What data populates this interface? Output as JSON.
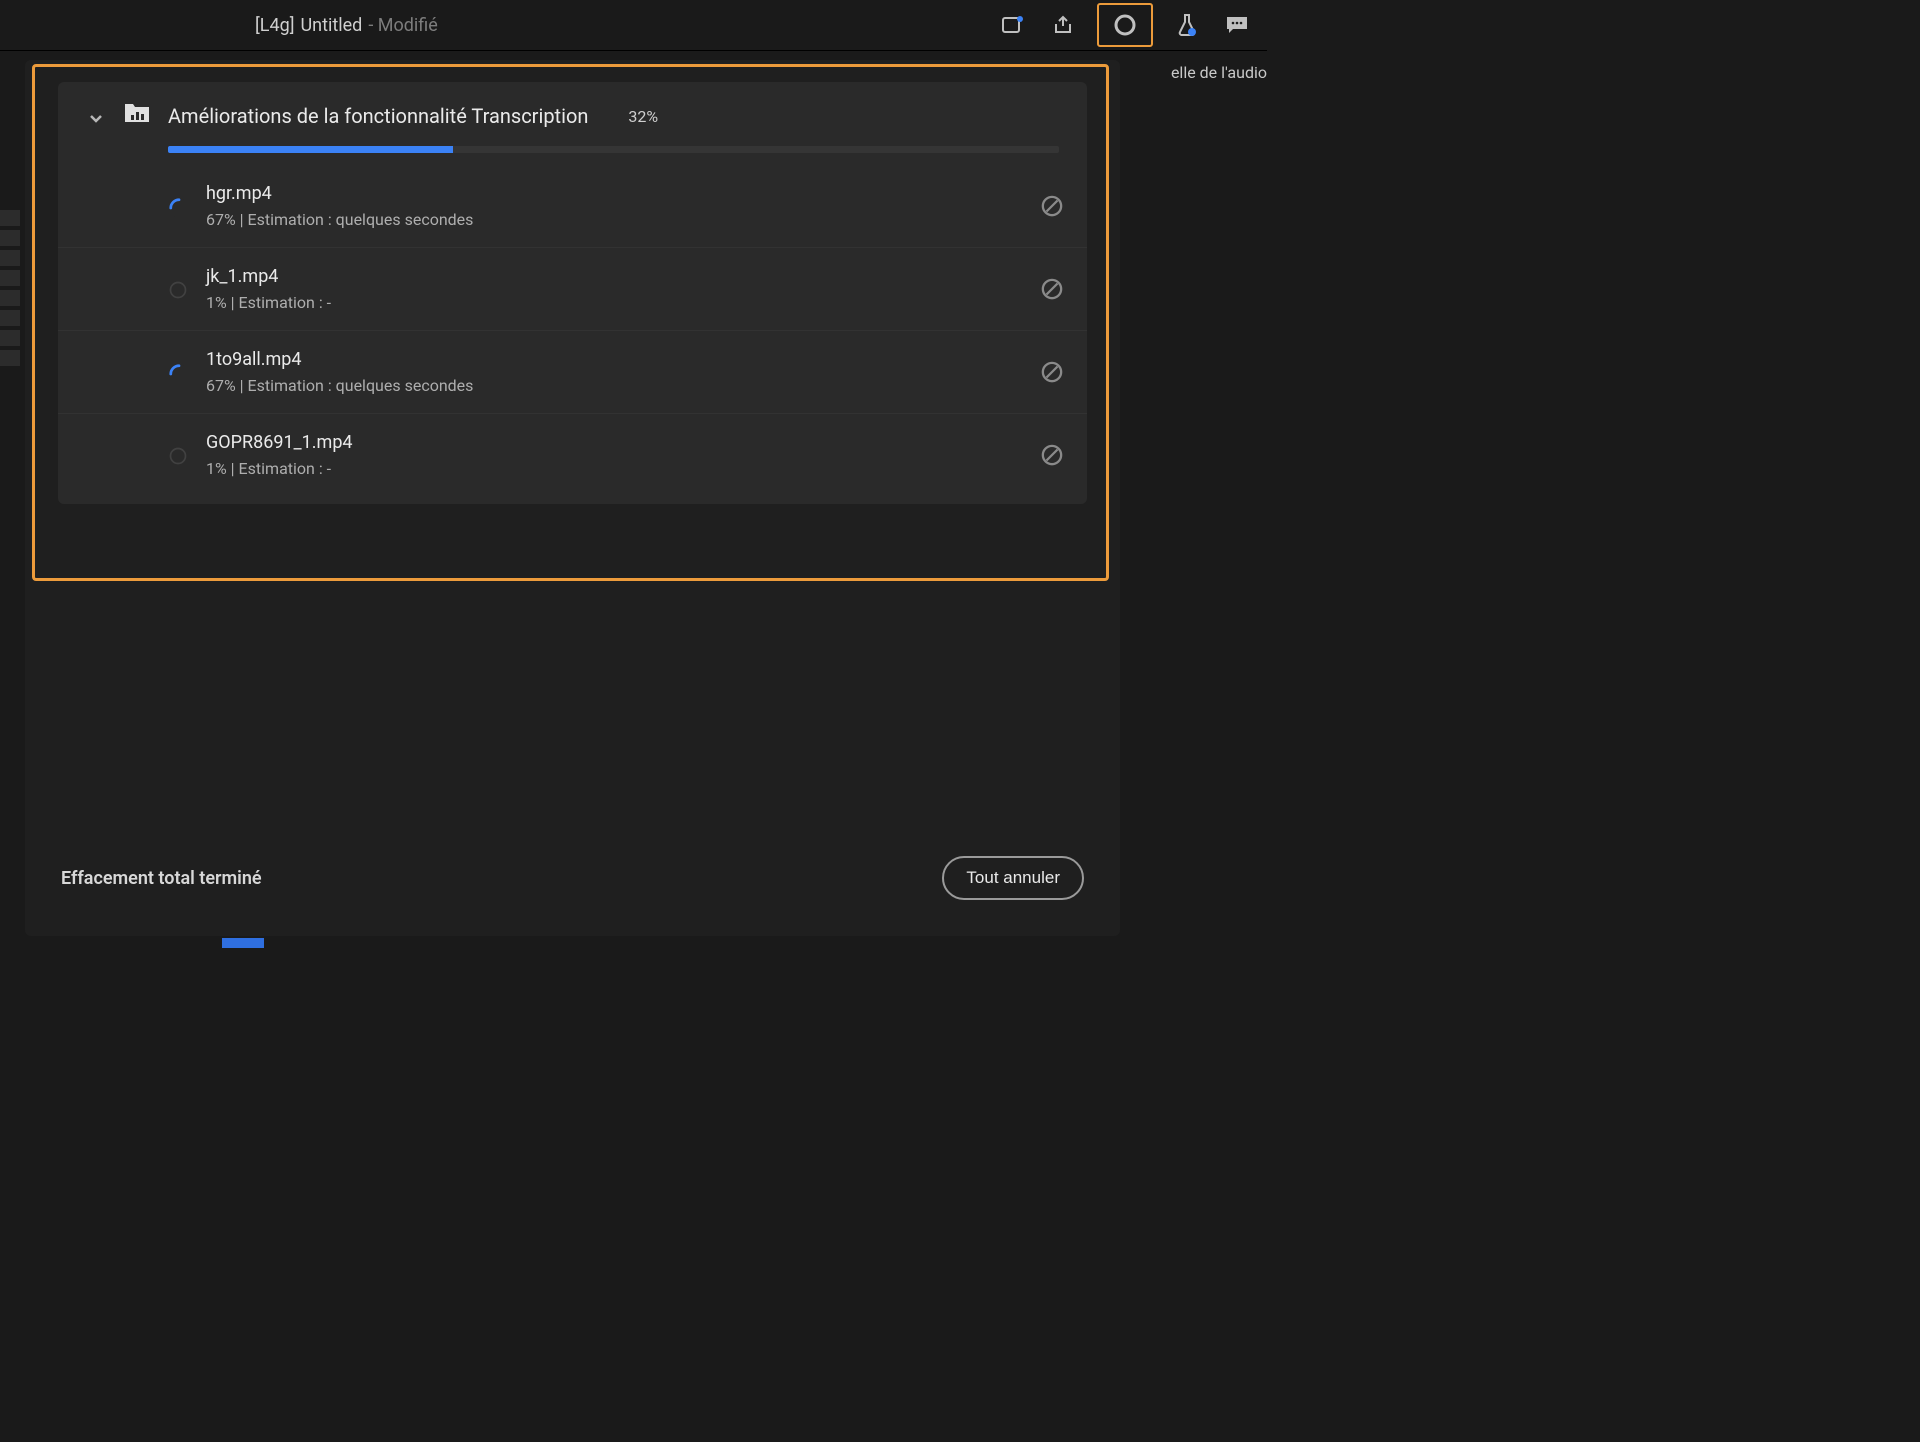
{
  "titlebar": {
    "prefix": "[L4g]",
    "name": "Untitled",
    "modified": "- Modifié"
  },
  "partial_right_text": "elle de l'audio",
  "panel": {
    "title": "Améliorations de la fonctionnalité Transcription",
    "percent_label": "32%",
    "progress_percent": 32,
    "footer_status": "Effacement total terminé",
    "cancel_all_label": "Tout annuler"
  },
  "jobs": [
    {
      "spinner": "active",
      "name": "hgr.mp4",
      "status": "67%  |  Estimation : quelques secondes"
    },
    {
      "spinner": "idle",
      "name": "jk_1.mp4",
      "status": "1%  |  Estimation : -"
    },
    {
      "spinner": "active",
      "name": "1to9all.mp4",
      "status": "67%  |  Estimation : quelques secondes"
    },
    {
      "spinner": "idle",
      "name": "GOPR8691_1.mp4",
      "status": "1%  |  Estimation : -"
    }
  ],
  "icons": {
    "note": "notification-icon",
    "share": "share-icon",
    "circle": "progress-circle-icon",
    "flask": "flask-icon",
    "chat": "chat-icon"
  }
}
